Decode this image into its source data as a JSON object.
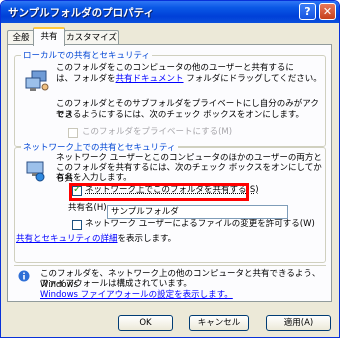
{
  "window": {
    "title": "サンプルフォルダのプロパティ",
    "help_label": "?",
    "close_label": "✕"
  },
  "tabs": [
    {
      "label": "全般"
    },
    {
      "label": "共有"
    },
    {
      "label": "カスタマイズ"
    }
  ],
  "local": {
    "group_title": "ローカルでの共有とセキュリティ",
    "line1": "このフォルダをこのコンピュータの他のユーザーと共有するに",
    "line2_pre": "は、フォルダを",
    "line2_link": "共有ドキュメント",
    "line2_post": " フォルダにドラッグしてください。",
    "line3": "このフォルダとそのサブフォルダをプライベートにし自分のみがアクセス",
    "line4": "できるようにするには、次のチェック ボックスをオンにします。",
    "private_label": "このフォルダをプライベートにする(M)"
  },
  "network": {
    "group_title": "ネットワーク上での共有とセキュリティ",
    "line1": "ネットワーク ユーザーとこのコンピュータのほかのユーザーの両方と",
    "line2": "このフォルダを共有するには、次のチェック ボックスをオンにしてから共",
    "line3": "有名を入力します。",
    "share_label": "ネットワーク上でこのフォルダを共有する(S)",
    "share_name_label": "共有名(H):",
    "share_name_value": "サンプルフォルダ",
    "allow_change_label": "ネットワーク ユーザーによるファイルの変更を許可する(W)",
    "details_link": "共有とセキュリティの詳細",
    "details_post": "を表示します。"
  },
  "firewall": {
    "line1": "このフォルダを、ネットワーク上の他のコンピュータと共有できるよう、Windows",
    "line2": "ファイアウォールは構成されています。",
    "link": "Windows ファイアウォールの設定を表示します。"
  },
  "buttons": {
    "ok": "OK",
    "cancel": "キャンセル",
    "apply": "適用(A)"
  },
  "checkboxes": {
    "private_checked": false,
    "share_checked": true,
    "allow_change_checked": false
  }
}
